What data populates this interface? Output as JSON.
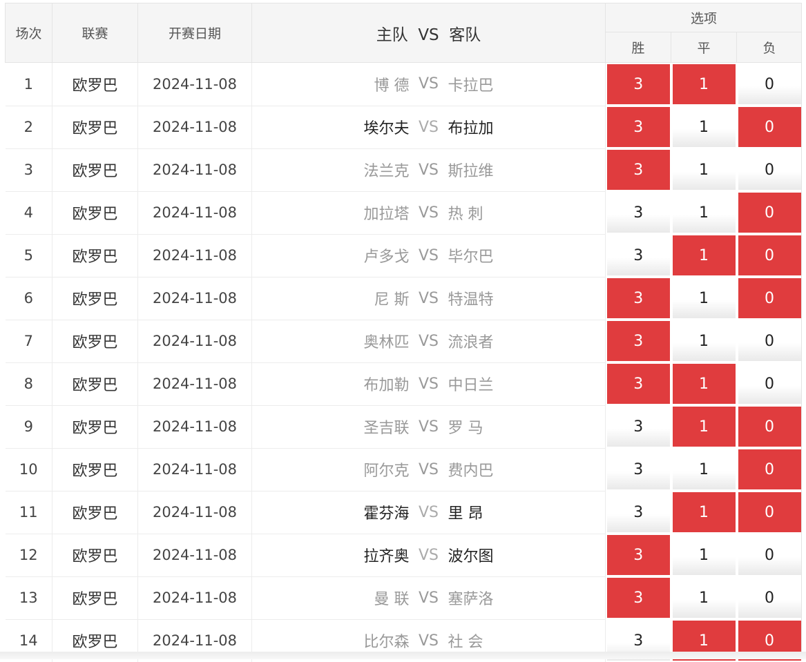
{
  "header": {
    "col_index": "场次",
    "col_league": "联赛",
    "col_date": "开赛日期",
    "col_match_home": "主队",
    "col_match_vs": "VS",
    "col_match_away": "客队",
    "col_options": "选项",
    "opt_win": "胜",
    "opt_draw": "平",
    "opt_loss": "负"
  },
  "colors": {
    "selected": "#e03c3e",
    "header_bg": "#f5f5f5"
  },
  "rows": [
    {
      "idx": "1",
      "league": "欧罗巴",
      "date": "2024-11-08",
      "home": "博 德",
      "vs": "VS",
      "away": "卡拉巴",
      "style": "dim",
      "win": "3",
      "draw": "1",
      "loss": "0",
      "sel": [
        true,
        true,
        false
      ]
    },
    {
      "idx": "2",
      "league": "欧罗巴",
      "date": "2024-11-08",
      "home": "埃尔夫",
      "vs": "VS",
      "away": "布拉加",
      "style": "hl",
      "win": "3",
      "draw": "1",
      "loss": "0",
      "sel": [
        true,
        false,
        true
      ]
    },
    {
      "idx": "3",
      "league": "欧罗巴",
      "date": "2024-11-08",
      "home": "法兰克",
      "vs": "VS",
      "away": "斯拉维",
      "style": "dim",
      "win": "3",
      "draw": "1",
      "loss": "0",
      "sel": [
        true,
        false,
        false
      ]
    },
    {
      "idx": "4",
      "league": "欧罗巴",
      "date": "2024-11-08",
      "home": "加拉塔",
      "vs": "VS",
      "away": "热 刺",
      "style": "dim",
      "win": "3",
      "draw": "1",
      "loss": "0",
      "sel": [
        false,
        false,
        true
      ]
    },
    {
      "idx": "5",
      "league": "欧罗巴",
      "date": "2024-11-08",
      "home": "卢多戈",
      "vs": "VS",
      "away": "毕尔巴",
      "style": "dim",
      "win": "3",
      "draw": "1",
      "loss": "0",
      "sel": [
        false,
        true,
        true
      ]
    },
    {
      "idx": "6",
      "league": "欧罗巴",
      "date": "2024-11-08",
      "home": "尼 斯",
      "vs": "VS",
      "away": "特温特",
      "style": "dim",
      "win": "3",
      "draw": "1",
      "loss": "0",
      "sel": [
        true,
        false,
        true
      ]
    },
    {
      "idx": "7",
      "league": "欧罗巴",
      "date": "2024-11-08",
      "home": "奥林匹",
      "vs": "VS",
      "away": "流浪者",
      "style": "dim",
      "win": "3",
      "draw": "1",
      "loss": "0",
      "sel": [
        true,
        false,
        false
      ]
    },
    {
      "idx": "8",
      "league": "欧罗巴",
      "date": "2024-11-08",
      "home": "布加勒",
      "vs": "VS",
      "away": "中日兰",
      "style": "dim",
      "win": "3",
      "draw": "1",
      "loss": "0",
      "sel": [
        true,
        true,
        false
      ]
    },
    {
      "idx": "9",
      "league": "欧罗巴",
      "date": "2024-11-08",
      "home": "圣吉联",
      "vs": "VS",
      "away": "罗 马",
      "style": "dim",
      "win": "3",
      "draw": "1",
      "loss": "0",
      "sel": [
        false,
        true,
        true
      ]
    },
    {
      "idx": "10",
      "league": "欧罗巴",
      "date": "2024-11-08",
      "home": "阿尔克",
      "vs": "VS",
      "away": "费内巴",
      "style": "dim",
      "win": "3",
      "draw": "1",
      "loss": "0",
      "sel": [
        false,
        false,
        true
      ]
    },
    {
      "idx": "11",
      "league": "欧罗巴",
      "date": "2024-11-08",
      "home": "霍芬海",
      "vs": "VS",
      "away": "里 昂",
      "style": "hl",
      "win": "3",
      "draw": "1",
      "loss": "0",
      "sel": [
        false,
        true,
        true
      ]
    },
    {
      "idx": "12",
      "league": "欧罗巴",
      "date": "2024-11-08",
      "home": "拉齐奥",
      "vs": "VS",
      "away": "波尔图",
      "style": "hl",
      "win": "3",
      "draw": "1",
      "loss": "0",
      "sel": [
        true,
        false,
        false
      ]
    },
    {
      "idx": "13",
      "league": "欧罗巴",
      "date": "2024-11-08",
      "home": "曼 联",
      "vs": "VS",
      "away": "塞萨洛",
      "style": "dim",
      "win": "3",
      "draw": "1",
      "loss": "0",
      "sel": [
        true,
        false,
        false
      ]
    },
    {
      "idx": "14",
      "league": "欧罗巴",
      "date": "2024-11-08",
      "home": "比尔森",
      "vs": "VS",
      "away": "社 会",
      "style": "dim",
      "win": "3",
      "draw": "1",
      "loss": "0",
      "sel": [
        false,
        true,
        true
      ]
    }
  ]
}
